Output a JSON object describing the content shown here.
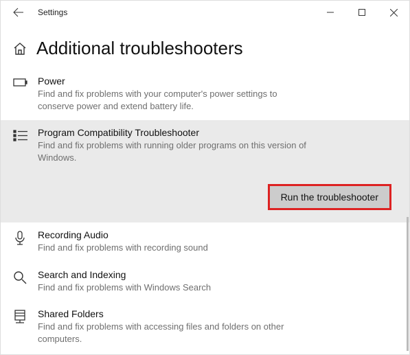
{
  "window": {
    "title": "Settings"
  },
  "header": {
    "title": "Additional troubleshooters"
  },
  "items": [
    {
      "title": "Power",
      "desc": "Find and fix problems with your computer's power settings to conserve power and extend battery life."
    },
    {
      "title": "Program Compatibility Troubleshooter",
      "desc": "Find and fix problems with running older programs on this version of Windows."
    },
    {
      "title": "Recording Audio",
      "desc": "Find and fix problems with recording sound"
    },
    {
      "title": "Search and Indexing",
      "desc": "Find and fix problems with Windows Search"
    },
    {
      "title": "Shared Folders",
      "desc": "Find and fix problems with accessing files and folders on other computers."
    }
  ],
  "actions": {
    "run": "Run the troubleshooter"
  }
}
